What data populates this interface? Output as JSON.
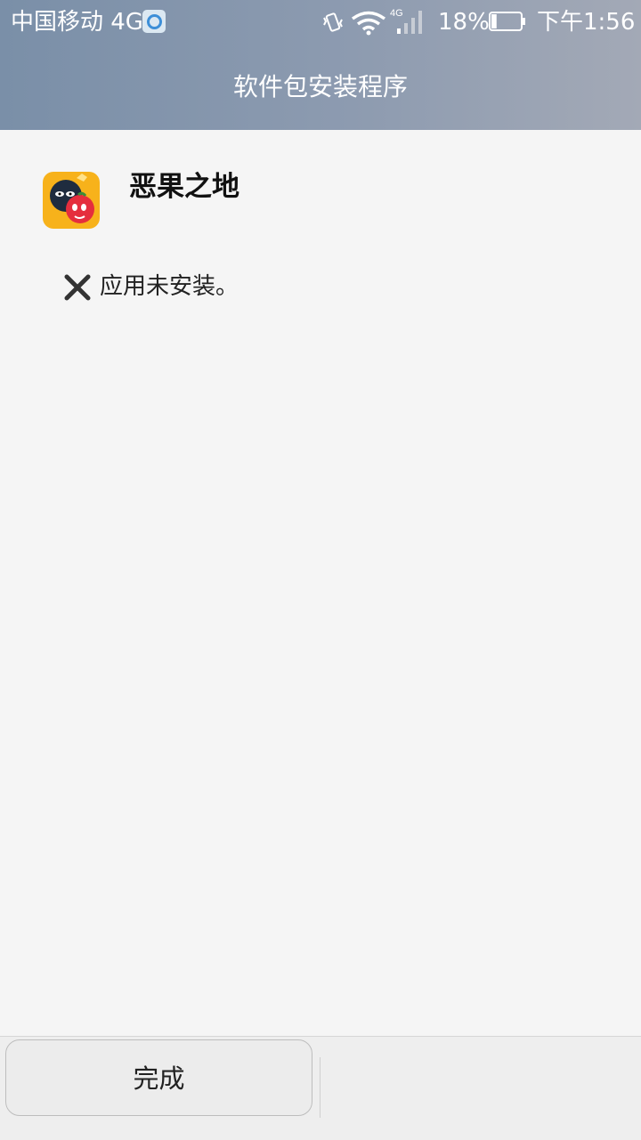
{
  "status_bar": {
    "carrier": "中国移动 4G",
    "network_label": "4G",
    "battery_percent": "18%",
    "time": "下午1:56",
    "battery_level": 0.18
  },
  "header": {
    "title": "软件包安装程序"
  },
  "app": {
    "name": "恶果之地",
    "icon": "app-icon",
    "accent": "#f7b21b"
  },
  "result": {
    "message": "应用未安装。",
    "icon": "close-icon"
  },
  "footer": {
    "done_label": "完成"
  }
}
